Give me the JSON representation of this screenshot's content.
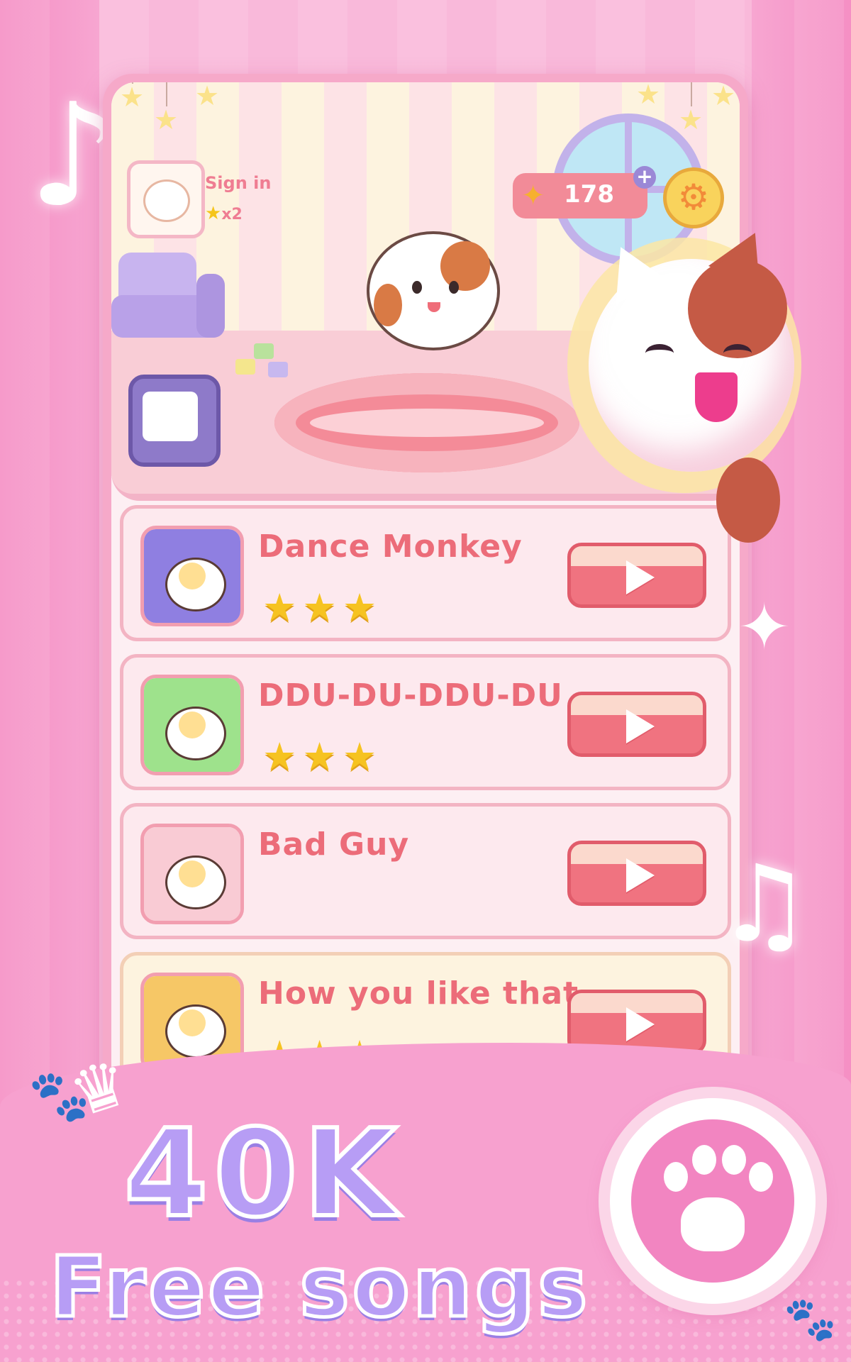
{
  "header": {
    "sign_in_label": "Sign in",
    "sign_in_reward": "x2",
    "coins_value": "178",
    "coins_plus": "+",
    "gear_icon": "⚙",
    "fish_icon": "fish-coin-icon"
  },
  "songs": [
    {
      "title": "Dance Monkey",
      "stars": "★★★",
      "thumb_color": "#8f7fe1",
      "row_style": "pink"
    },
    {
      "title": "DDU-DU-DDU-DU",
      "stars": "★★★",
      "thumb_color": "#9ee28c",
      "row_style": "pink"
    },
    {
      "title": "Bad Guy",
      "stars": "",
      "thumb_color": "#f9cbd4",
      "row_style": "pink"
    },
    {
      "title": "How you like that",
      "stars": "★★★",
      "thumb_color": "#f6c766",
      "row_style": "yellow"
    }
  ],
  "promo": {
    "headline_big": "40K",
    "headline_small": "Free songs"
  },
  "colors": {
    "accent_pink": "#ec6c79",
    "star_yellow": "#f6c321",
    "play_red": "#f07380",
    "headline_purple": "#b79df5"
  }
}
